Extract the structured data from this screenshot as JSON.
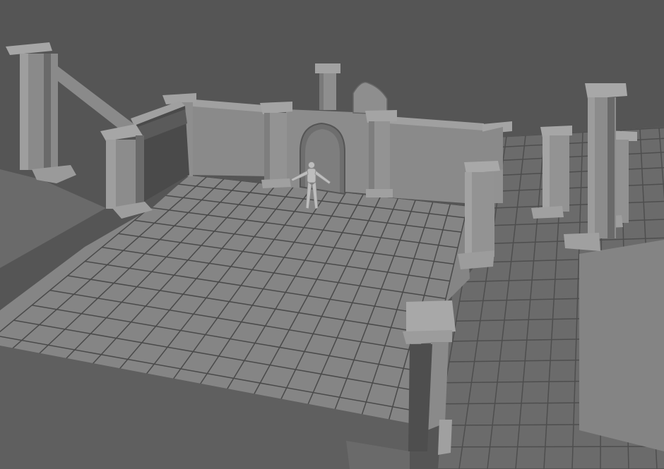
{
  "scene": {
    "view": "3d-perspective-viewport",
    "shading": "untextured-gray",
    "colors": {
      "background": "#555555",
      "floor_top": "#858585",
      "floor_right": "#6b6b6b",
      "floor_lower": "#636363",
      "grid_line": "#454545",
      "wall_face": "#8c8c8c",
      "wall_light": "#9c9c9c",
      "wall_shadow": "#5e5e5e",
      "wall_dark": "#4a4a4a",
      "pillar": "#939393",
      "character": "#bdbdbd"
    },
    "objects": [
      "ground-plane",
      "tiled-floor",
      "back-wall",
      "left-wall",
      "right-wall",
      "arched-doorway",
      "gothic-window",
      "column-left",
      "column-right",
      "pillar-block",
      "character-model"
    ]
  }
}
